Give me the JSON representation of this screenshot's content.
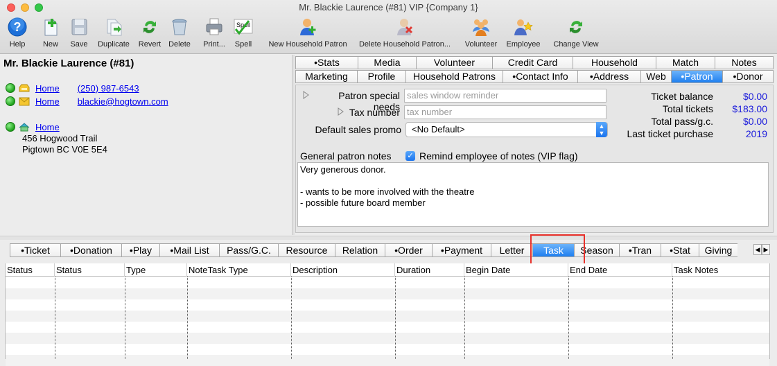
{
  "window": {
    "title": "Mr. Blackie Laurence (#81) VIP {Company 1}"
  },
  "toolbar": {
    "help": "Help",
    "new": "New",
    "save": "Save",
    "duplicate": "Duplicate",
    "revert": "Revert",
    "delete": "Delete",
    "print": "Print...",
    "spell": "Spell",
    "new_household": "New Household Patron",
    "delete_household": "Delete Household Patron...",
    "volunteer": "Volunteer",
    "employee": "Employee",
    "change_view": "Change View",
    "spell_badge": "Spell"
  },
  "patron": {
    "name": "Mr. Blackie Laurence (#81)",
    "phone_type": "Home",
    "phone": "(250) 987-6543",
    "email_type": "Home",
    "email": "blackie@hogtown.com",
    "address_type": "Home",
    "address_line1": "456 Hogwood Trail",
    "address_line2": "Pigtown BC  V0E 5E4"
  },
  "tabs_top_row1": [
    "•Stats",
    "Media",
    "Volunteer",
    "Credit Card",
    "Household",
    "Match",
    "Notes"
  ],
  "tabs_top_row2": [
    "Marketing",
    "Profile",
    "Household Patrons",
    "•Contact Info",
    "•Address",
    "Web",
    "•Patron",
    "•Donor"
  ],
  "tabs_top_selected": "•Patron",
  "patron_tab": {
    "special_needs_label": "Patron special needs",
    "special_needs_placeholder": "sales window reminder",
    "tax_label": "Tax number",
    "tax_placeholder": "tax number",
    "promo_label": "Default sales promo",
    "promo_value": "<No Default>",
    "notes_label": "General patron notes",
    "remind_label": "Remind employee of notes (VIP flag)",
    "notes_line1": "Very generous donor.",
    "notes_line2": "- wants to be more involved with the theatre",
    "notes_line3": "- possible future board member"
  },
  "stats": {
    "ticket_balance_label": "Ticket balance",
    "ticket_balance": "$0.00",
    "total_tickets_label": "Total tickets",
    "total_tickets": "$183.00",
    "total_pass_label": "Total pass/g.c.",
    "total_pass": "$0.00",
    "last_purchase_label": "Last ticket purchase",
    "last_purchase": "2019"
  },
  "tabs_bottom": [
    "•Ticket",
    "•Donation",
    "•Play",
    "•Mail List",
    "Pass/G.C.",
    "Resource",
    "Relation",
    "•Order",
    "•Payment",
    "Letter",
    "Task",
    "Season",
    "•Tran",
    "•Stat",
    "Giving"
  ],
  "tabs_bottom_selected": "Task",
  "grid_columns": [
    "Status",
    "Status",
    "Type",
    "NoteTask Type",
    "Description",
    "Duration",
    "Begin Date",
    "End Date",
    "Task Notes"
  ],
  "colors": {
    "accent": "#1f7ff0",
    "highlight": "#e8302a",
    "link": "#0000ee",
    "stat_value": "#1a1adb"
  }
}
